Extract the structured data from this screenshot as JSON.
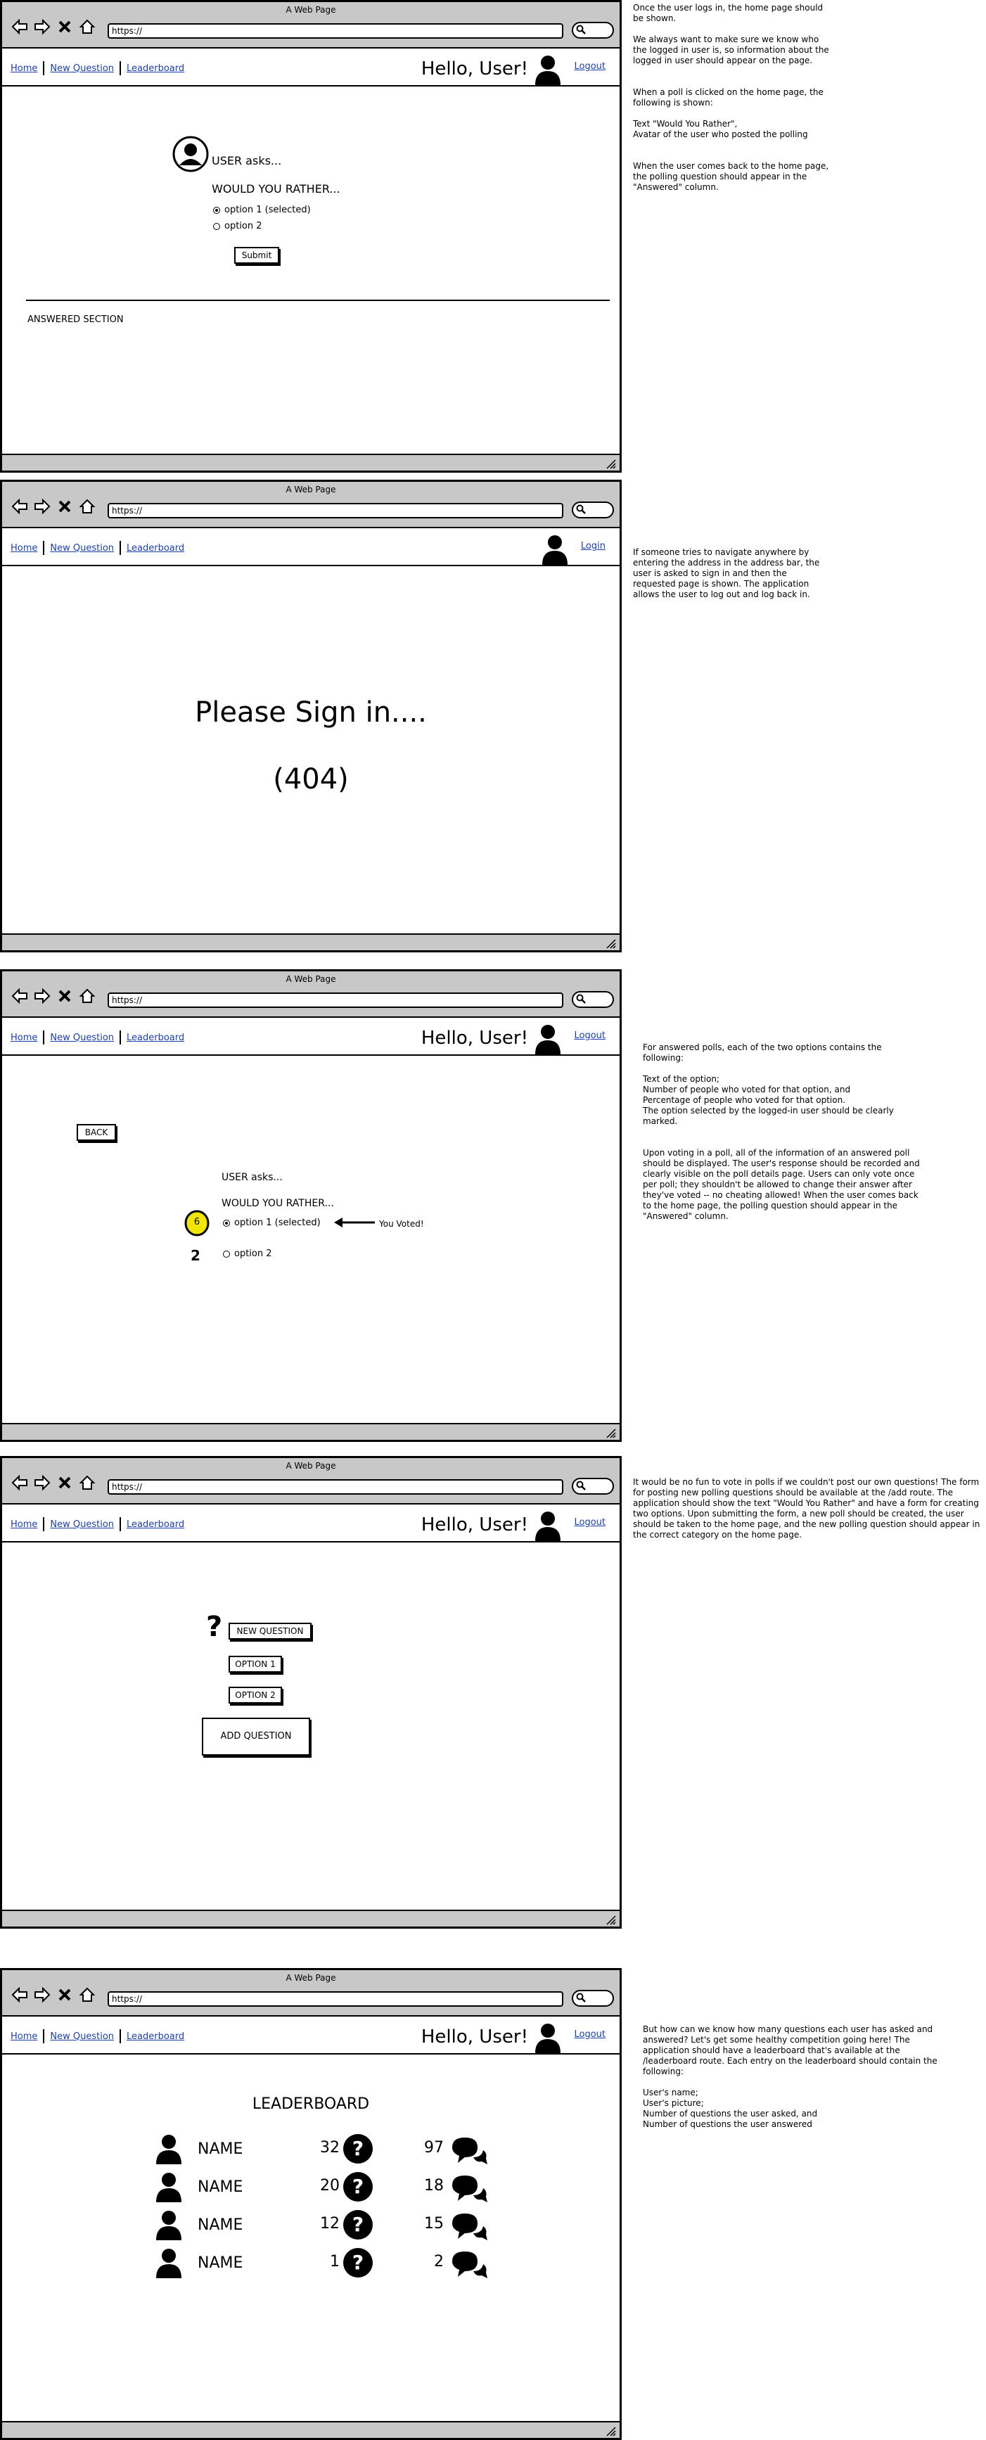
{
  "browser": {
    "window_title": "A Web Page",
    "url": "https://"
  },
  "nav": {
    "home": "Home",
    "new_question": "New Question",
    "leaderboard": "Leaderboard",
    "hello": "Hello, User!",
    "logout": "Logout",
    "login": "Login"
  },
  "screen1": {
    "user_asks": "USER asks...",
    "wyr": "WOULD YOU RATHER...",
    "option1": "option 1 (selected)",
    "option2": "option 2",
    "submit": "Submit",
    "answered_section": "ANSWERED SECTION",
    "note": "Once the user logs in, the home page should be shown.\n\nWe always want to make sure we know who the logged in user is, so information about the logged in user should appear on the page.\n\n\nWhen a poll is clicked on the home page, the following is shown:\n\nText \"Would You Rather\",\nAvatar of the user who posted the polling\n\n\nWhen the user comes back to the home page, the polling question should appear in the \"Answered\" column."
  },
  "screen2": {
    "signin": "Please Sign in....",
    "code": "(404)",
    "note": "If someone tries to navigate anywhere by entering the address in the address bar, the user is asked to sign in and then the requested page is shown. The application allows the user to log out and log back in."
  },
  "screen3": {
    "back": "BACK",
    "user_asks": "USER asks...",
    "wyr": "WOULD YOU RATHER...",
    "option1": "option 1 (selected)",
    "option2": "option 2",
    "you_voted": "You Voted!",
    "votes1": "6",
    "votes2": "2",
    "note": "For answered polls, each of the two options contains the following:\n\nText of the option;\nNumber of people who voted for that option, and\nPercentage of people who voted for that option.\nThe option selected by the logged-in user should be clearly marked.\n\n\nUpon voting in a poll, all of the information of an answered poll should be displayed. The user's response should be recorded and clearly visible on the poll details page. Users can only vote once per poll; they shouldn't be allowed to change their answer after they've voted -- no cheating allowed! When the user comes back to the home page, the polling question should appear in the \"Answered\" column."
  },
  "screen4": {
    "new_question": "NEW QUESTION",
    "option1": "OPTION 1",
    "option2": "OPTION 2",
    "add_question": "ADD QUESTION",
    "note": "It would be no fun to vote in polls if we couldn't post our own questions! The form for posting new polling questions should be available at the /add route. The application should show the text \"Would You Rather\" and have a form for creating two options. Upon submitting the form, a new poll should be created, the user should be taken to the home page, and the new polling question should appear in the correct category on the home page."
  },
  "screen5": {
    "title": "LEADERBOARD",
    "rows": [
      {
        "name": "NAME",
        "asked": "32",
        "answered": "97"
      },
      {
        "name": "NAME",
        "asked": "20",
        "answered": "18"
      },
      {
        "name": "NAME",
        "asked": "12",
        "answered": "15"
      },
      {
        "name": "NAME",
        "asked": "1",
        "answered": "2"
      }
    ],
    "note": "But how can we know how many questions each user has asked and answered? Let's get some healthy competition going here! The application should have a leaderboard that's available at the /leaderboard route. Each entry on the leaderboard should contain the following:\n\nUser's name;\nUser's picture;\nNumber of questions the user asked, and\nNumber of questions the user answered"
  },
  "colors": {
    "chrome": "#c8c8c8",
    "link": "#1a3fb0",
    "highlight": "#f2e500"
  }
}
